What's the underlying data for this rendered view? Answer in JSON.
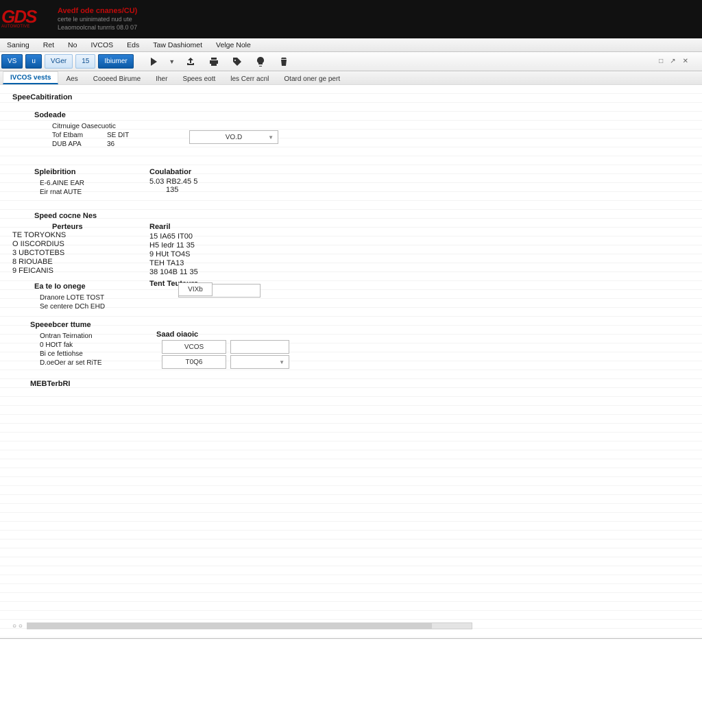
{
  "brand": {
    "logo_big": "GDS",
    "logo_small": "AUTOMOTIVE",
    "line1": "Avedf ode cnanes/CU)",
    "line2": "certe le uninimated nud ute",
    "line3": "Leaomoolcnal tunrris 08.0 07"
  },
  "menubar": [
    "Saning",
    "Ret",
    "No",
    "IVCOS",
    "Eds",
    "Taw Dashiomet",
    "Velge Nole"
  ],
  "toolbar": {
    "chips": [
      "VS",
      "u",
      "VGer",
      "15",
      "Ibiumer"
    ],
    "right": [
      "□",
      "↗",
      "✕"
    ]
  },
  "tabs": {
    "items": [
      "IVCOS vests",
      "Aes",
      "Cooeed Birume",
      "Iher",
      "Spees eott",
      "les Cerr acnl",
      "Otard oner ge pert"
    ],
    "active_index": 0
  },
  "page_title": "SpeeCabitiration",
  "sodeade": {
    "title": "Sodeade",
    "line1": "Citrnuige Oasecuotic",
    "r1k": "Tof Etbam",
    "r1v": "SE DIT",
    "r2k": "DUB APA",
    "r2v": "36"
  },
  "top_select": "VO.D",
  "spleibrition": {
    "title": "Spleibrition",
    "r1": "E-6.AINE EAR",
    "r2": "Eir rnat AUTE"
  },
  "calibration": {
    "title": "Coulabatior",
    "r1": "5.03 RB2.45 5",
    "r2": "135"
  },
  "speed_cocne": {
    "title": "Speed cocne Nes",
    "sub": "Perteurs",
    "items": [
      "TE TORYOKNS",
      "O IISCORDIUS",
      "3 UBCTOTEBS",
      "8 RIOUABE",
      "9 FEICANIS"
    ]
  },
  "result": {
    "title": "Rearil",
    "items": [
      "15 IA65 IT00",
      "H5 Iedr 11 35",
      "9 HUt TO4S",
      "TEH TA13",
      "38 104B 11 35"
    ]
  },
  "font_teunes": {
    "title": "Tent Teuteurs",
    "pair_left": "",
    "pair_right": "VIXb"
  },
  "eate_toonege": {
    "title": "Ea te Io onege",
    "r1": "Dranore LOTE TOST",
    "r2": "Se centere DCh EHD"
  },
  "speed_tume": {
    "title": "Speeebcer ttume",
    "r1": "Ontran Teirnation",
    "r2": "0 HOtT fak",
    "r3": "Bi ce fettiohse",
    "r4": "D.oeOer ar set RiTE"
  },
  "saad_oiaoic": {
    "title": "Saad oiaoic",
    "v1": "VCOS",
    "v2": "T0Q6",
    "blank": "",
    "dd": ""
  },
  "footer_section": "MEBTerbRI",
  "status_left": "○ ○"
}
